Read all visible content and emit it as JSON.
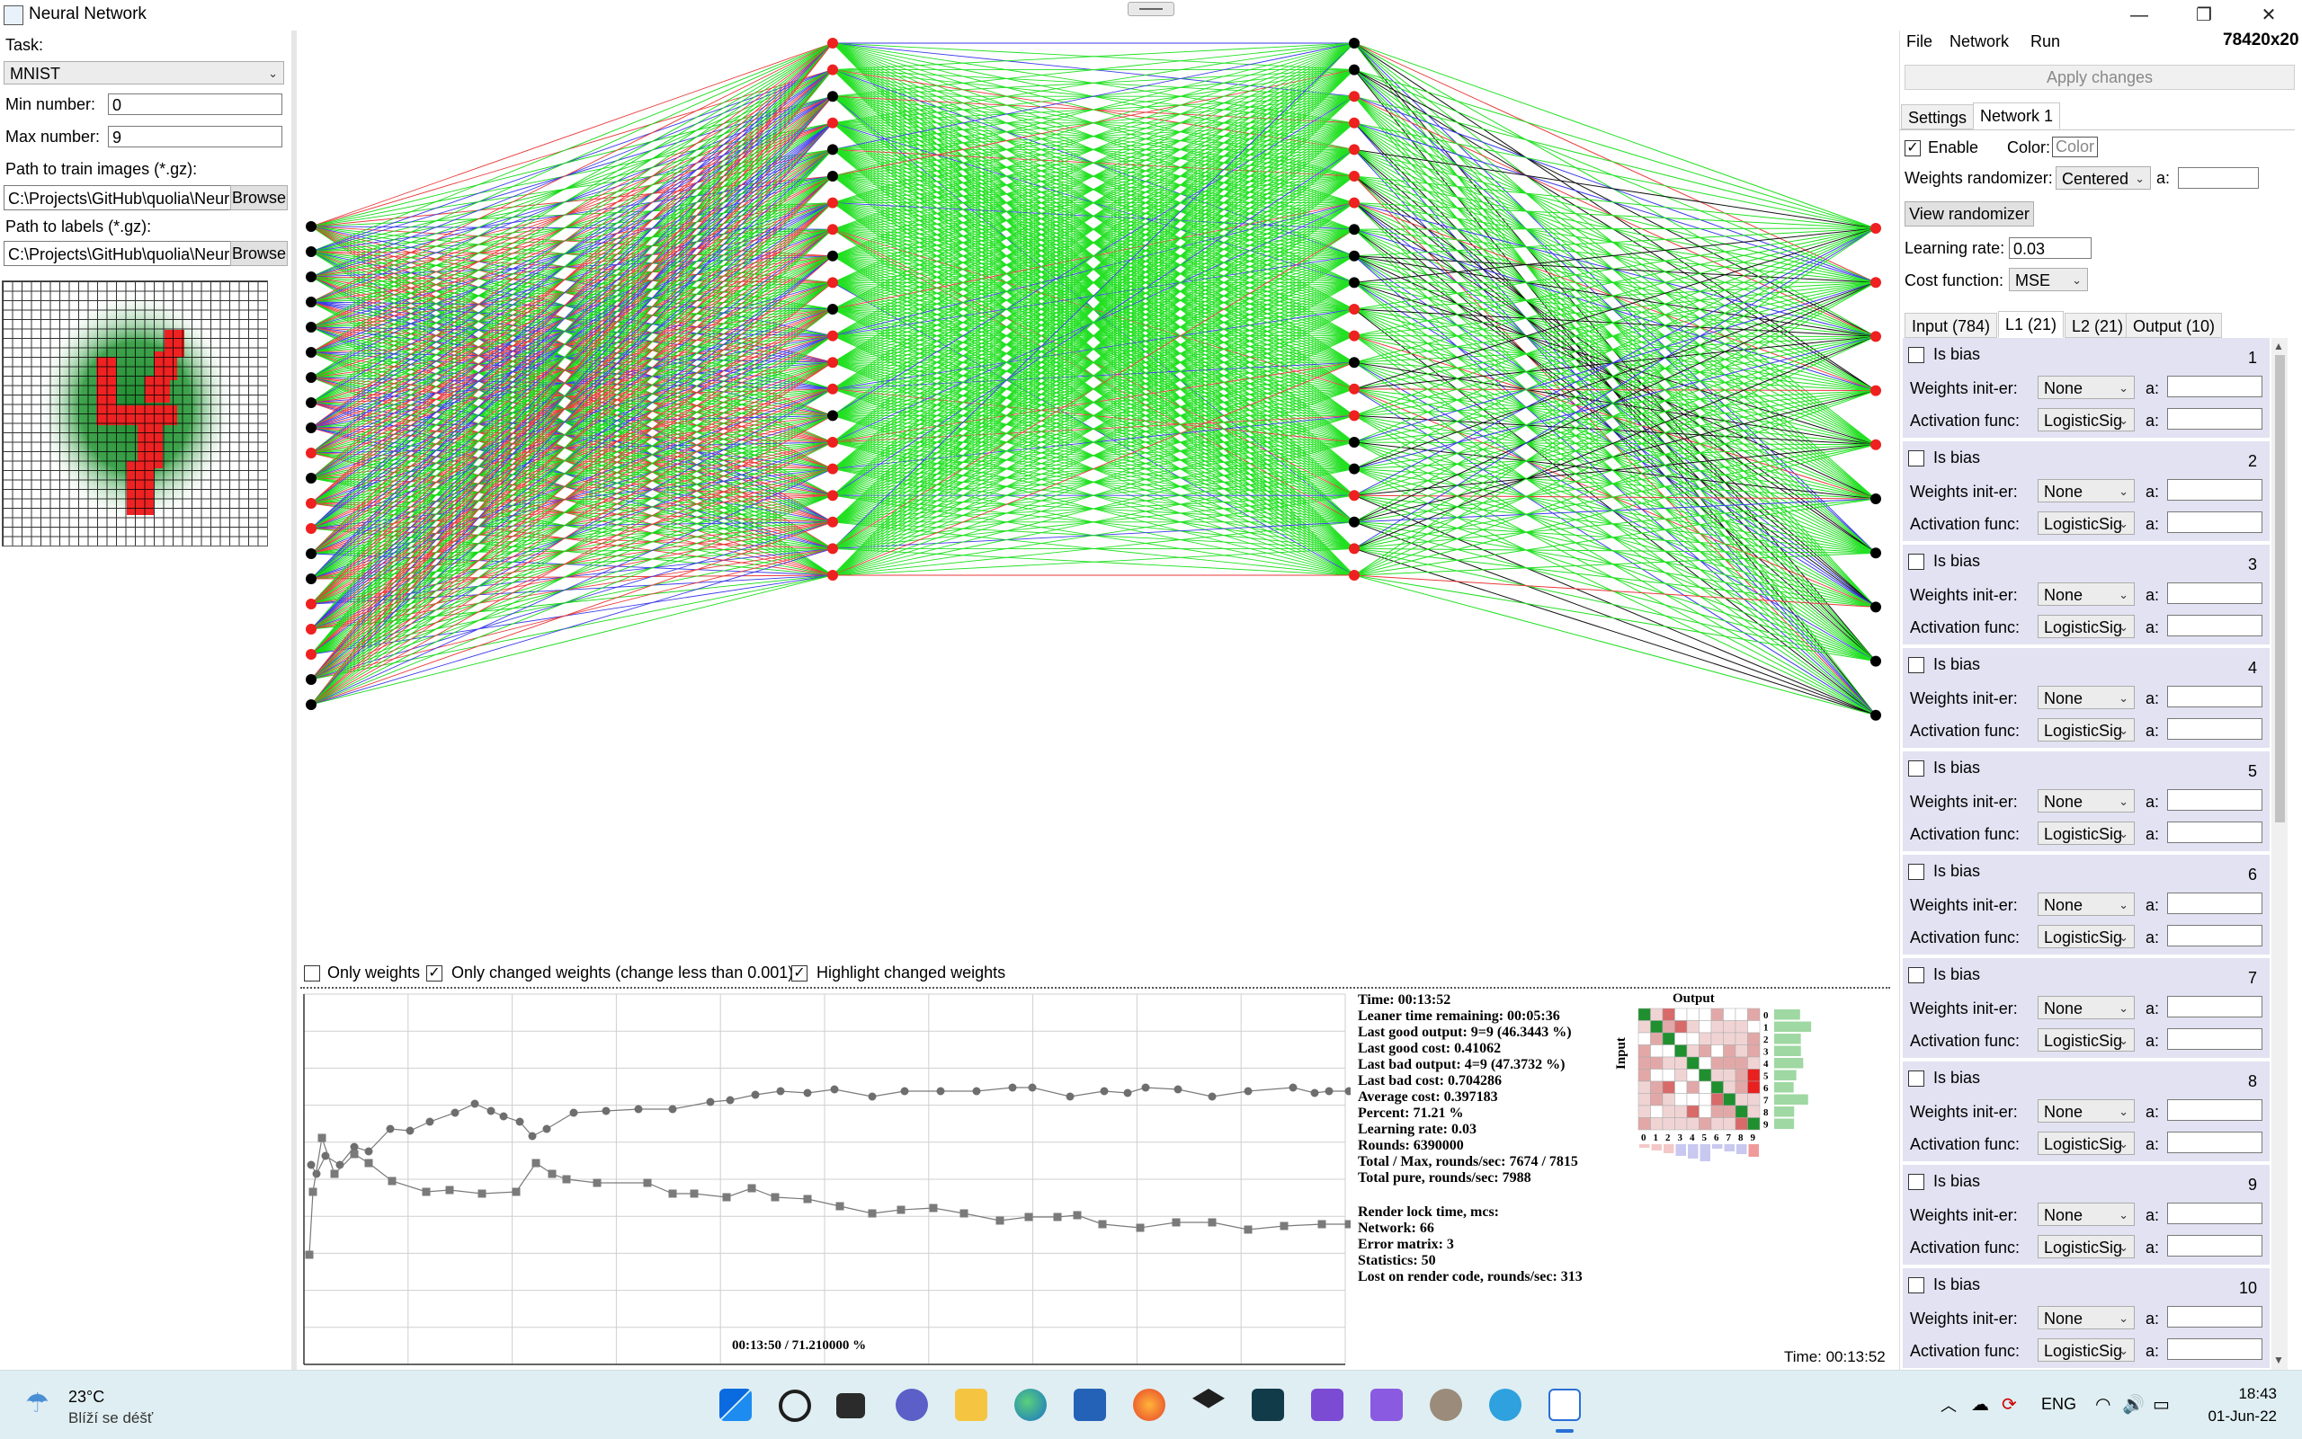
{
  "window": {
    "title": "Neural Network",
    "minimize": "—",
    "restore": "❐",
    "close": "✕"
  },
  "left_panel": {
    "task_label": "Task:",
    "task_value": "MNIST",
    "min_label": "Min number:",
    "min_value": "0",
    "max_label": "Max number:",
    "max_value": "9",
    "train_label": "Path to train images (*.gz):",
    "train_path": "C:\\Projects\\GitHub\\quolia\\Neur",
    "labels_label": "Path to labels (*.gz):",
    "labels_path": "C:\\Projects\\GitHub\\quolia\\Neur",
    "browse": "Browse"
  },
  "canvas_options": {
    "only_weights": "Only weights",
    "only_changed": "Only changed weights (change less than 0.001)",
    "highlight": "Highlight changed weights"
  },
  "stats": [
    "Time: 00:13:52",
    "Leaner time remaining: 00:05:36",
    "Last good output: 9=9 (46.3443 %)",
    "Last good cost: 0.41062",
    "Last bad output: 4=9 (47.3732 %)",
    "Last bad cost: 0.704286",
    "Average cost: 0.397183",
    "Percent: 71.21 %",
    "Learning rate: 0.03",
    "Rounds: 6390000",
    "Total / Max, rounds/sec: 7674 / 7815",
    "Total pure, rounds/sec: 7988"
  ],
  "render_stats": [
    "Render lock time, mcs:",
    "Network: 66",
    "Error matrix: 3",
    "Statistics: 50",
    "Lost on render code, rounds/sec: 313"
  ],
  "matrix": {
    "title": "Output",
    "ylabel": "Input",
    "digits": [
      "0",
      "1",
      "2",
      "3",
      "4",
      "5",
      "6",
      "7",
      "8",
      "9"
    ]
  },
  "chart_caption": "00:13:50 / 71.210000 %",
  "time_footer": "Time: 00:13:52",
  "right_panel": {
    "menu": [
      "File",
      "Network",
      "Run"
    ],
    "network_size": "78420x20",
    "apply": "Apply changes",
    "tabs": [
      "Settings",
      "Network 1"
    ],
    "enable": "Enable",
    "color_label": "Color:",
    "color_btn": "Color",
    "randomizer_label": "Weights randomizer:",
    "randomizer_value": "Centered",
    "a_label": "a:",
    "view_randomizer": "View randomizer",
    "learning_label": "Learning rate:",
    "learning_value": "0.03",
    "cost_label": "Cost function:",
    "cost_value": "MSE",
    "layer_tabs": [
      "Input (784)",
      "L1 (21)",
      "L2 (21)",
      "Output (10)"
    ],
    "is_bias": "Is bias",
    "weights_init": "Weights init-er:",
    "weights_init_value": "None",
    "activation": "Activation func:",
    "activation_value": "LogisticSig",
    "neurons": [
      "1",
      "2",
      "3",
      "4",
      "5",
      "6",
      "7",
      "8",
      "9",
      "10"
    ]
  },
  "taskbar": {
    "temp": "23°C",
    "weather": "Blíží se déšť",
    "lang": "ENG",
    "time": "18:43",
    "date": "01-Jun-22"
  }
}
